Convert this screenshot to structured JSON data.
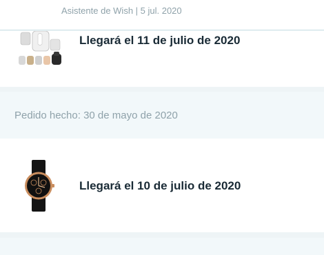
{
  "header": {
    "meta": "Asistente de Wish | 5 jul. 2020"
  },
  "orders": [
    {
      "product_icon": "earbuds-product-image",
      "delivery": "Llegará el 11 de julio de 2020"
    },
    {
      "product_icon": "wristwatch-product-image",
      "delivery": "Llegará el 10 de julio de 2020"
    }
  ],
  "order_group": {
    "placed": "Pedido hecho: 30 de mayo de 2020"
  }
}
